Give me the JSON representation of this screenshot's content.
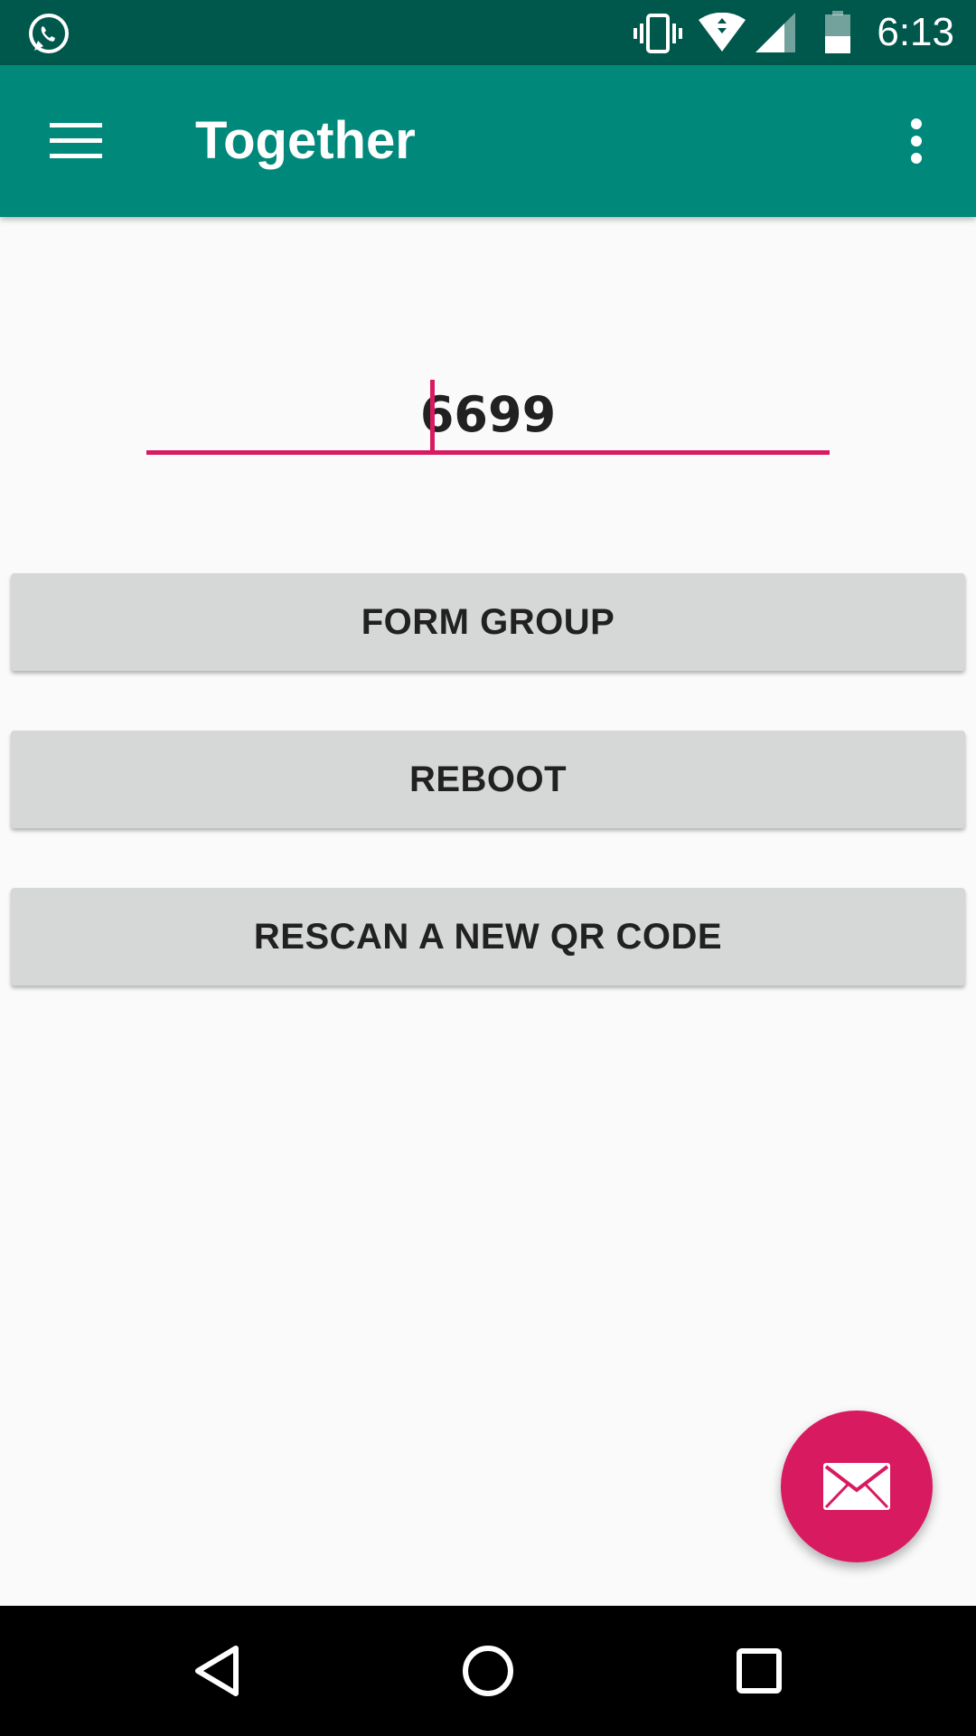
{
  "status_bar": {
    "time": "6:13",
    "icons": [
      "whatsapp-icon",
      "vibrate-icon",
      "wifi-icon",
      "signal-icon",
      "battery-icon"
    ]
  },
  "app_bar": {
    "title": "Together",
    "menu_icon": "hamburger-menu-icon",
    "overflow_icon": "more-vert-icon"
  },
  "code_input": {
    "value": "6699",
    "accent_color": "#d81b60"
  },
  "buttons": {
    "form_group": "FORM GROUP",
    "reboot": "REBOOT",
    "rescan": "RESCAN A NEW QR CODE"
  },
  "fab": {
    "icon": "mail-icon",
    "color": "#d81b60"
  },
  "nav_bar": {
    "icons": [
      "back-icon",
      "home-icon",
      "recents-icon"
    ]
  },
  "colors": {
    "status_bar": "#00574b",
    "app_bar": "#00897b",
    "background": "#fafafa",
    "button": "#d6d7d7"
  }
}
